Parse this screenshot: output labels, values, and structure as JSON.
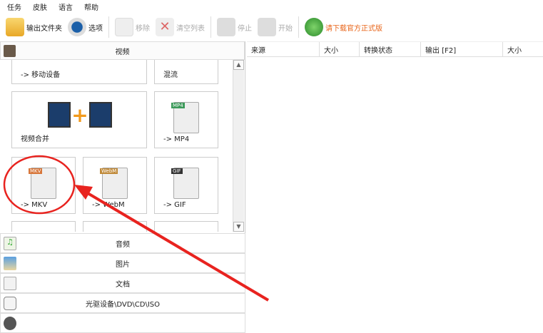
{
  "menu": [
    "任务",
    "皮肤",
    "语言",
    "帮助"
  ],
  "toolbar": {
    "output_folder": "输出文件夹",
    "options": "选项",
    "remove": "移除",
    "clear_list": "清空列表",
    "stop": "停止",
    "start": "开始",
    "download": "请下载官方正式版"
  },
  "left": {
    "header": "视频",
    "tiles": {
      "mobile": "-> 移动设备",
      "mux": "混流",
      "merge": "视频合并",
      "mp4": "-> MP4",
      "mkv": "-> MKV",
      "webm": "-> WebM",
      "gif": "-> GIF",
      "mp4_badge": "MP4",
      "mkv_badge": "MKV",
      "webm_badge": "WebM",
      "gif_badge": "GIF"
    },
    "categories": [
      "音频",
      "图片",
      "文档",
      "光驱设备\\DVD\\CD\\ISO"
    ]
  },
  "right": {
    "columns": [
      "来源",
      "大小",
      "转换状态",
      "输出 [F2]",
      "大小"
    ]
  },
  "colors": {
    "accent_orange": "#e8651a",
    "annotation_red": "#e8231f"
  }
}
